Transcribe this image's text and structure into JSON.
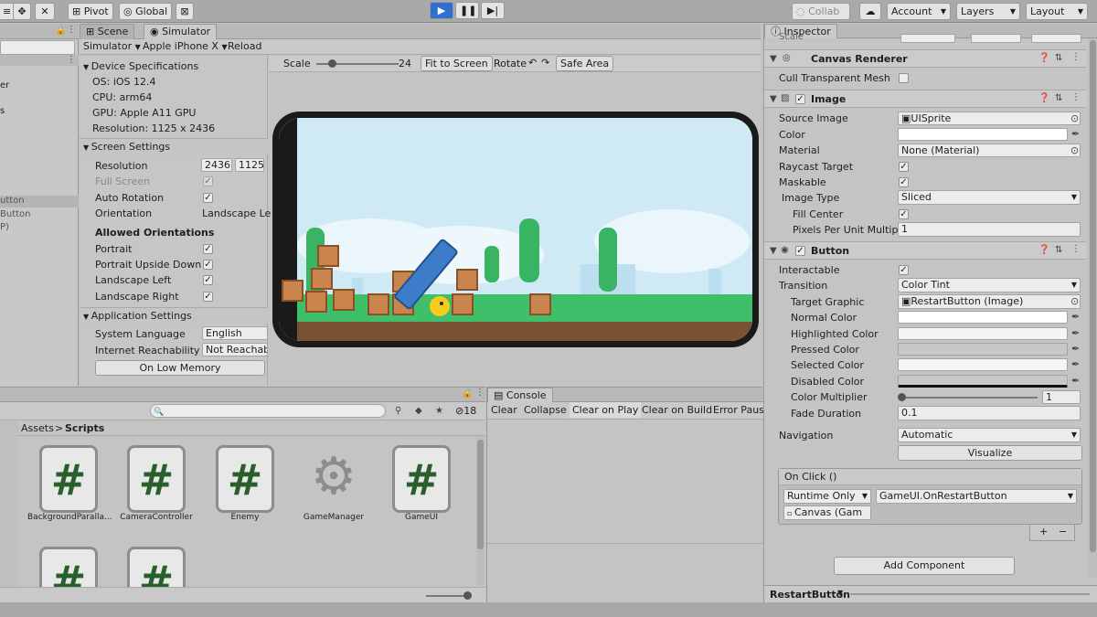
{
  "toolbar": {
    "pivot": "Pivot",
    "global": "Global",
    "collab": "Collab",
    "account": "Account",
    "layers": "Layers",
    "layout": "Layout"
  },
  "tabs": {
    "scene": "Scene",
    "simulator": "Simulator",
    "inspector": "Inspector",
    "console": "Console"
  },
  "hierarchy": {
    "items": [
      "er",
      "s",
      "",
      "",
      "utton",
      "Button",
      "P)"
    ]
  },
  "simulator": {
    "mode": "Simulator",
    "device": "Apple iPhone X",
    "reload": "Reload",
    "scale_label": "Scale",
    "scale_value": "24",
    "fit": "Fit to Screen",
    "rotate": "Rotate",
    "safe_area": "Safe Area",
    "device_spec_title": "Device Specifications",
    "os": "OS: iOS 12.4",
    "cpu": "CPU: arm64",
    "gpu": "GPU: Apple A11 GPU",
    "resolution": "Resolution: 1125 x 2436",
    "screen_settings_title": "Screen Settings",
    "res_label": "Resolution",
    "res_w": "2436",
    "res_h": "1125",
    "fullscreen": "Full Screen",
    "autorot": "Auto Rotation",
    "orientation": "Orientation",
    "orientation_val": "Landscape Le",
    "allowed_title": "Allowed Orientations",
    "portrait": "Portrait",
    "portrait_ud": "Portrait Upside Down",
    "land_left": "Landscape Left",
    "land_right": "Landscape Right",
    "app_settings_title": "Application Settings",
    "sys_lang": "System Language",
    "sys_lang_val": "English",
    "reach": "Internet Reachability",
    "reach_val": "Not Reachabl",
    "low_mem": "On Low Memory"
  },
  "project": {
    "crumb_root": "Assets",
    "crumb_sep": ">",
    "crumb_leaf": "Scripts",
    "count": "18",
    "assets": [
      "BackgroundParalla...",
      "CameraController",
      "Enemy",
      "GameManager",
      "GameUI"
    ]
  },
  "console": {
    "buttons": [
      "Clear",
      "Collapse",
      "Clear on Play",
      "Clear on Build",
      "Error Pause"
    ]
  },
  "inspector": {
    "scale_label": "Scale",
    "canvas_renderer": "Canvas Renderer",
    "cull": "Cull Transparent Mesh",
    "image_title": "Image",
    "source_image": "Source Image",
    "source_image_val": "UISprite",
    "color": "Color",
    "material": "Material",
    "material_val": "None (Material)",
    "raycast": "Raycast Target",
    "maskable": "Maskable",
    "image_type": "Image Type",
    "image_type_val": "Sliced",
    "fill_center": "Fill Center",
    "ppu": "Pixels Per Unit Multiplie",
    "ppu_val": "1",
    "button_title": "Button",
    "interactable": "Interactable",
    "transition": "Transition",
    "transition_val": "Color Tint",
    "target_graphic": "Target Graphic",
    "target_graphic_val": "RestartButton (Image)",
    "normal": "Normal Color",
    "highlighted": "Highlighted Color",
    "pressed": "Pressed Color",
    "selected": "Selected Color",
    "disabled": "Disabled Color",
    "multiplier": "Color Multiplier",
    "multiplier_val": "1",
    "fade": "Fade Duration",
    "fade_val": "0.1",
    "navigation": "Navigation",
    "navigation_val": "Automatic",
    "visualize": "Visualize",
    "onclick": "On Click ()",
    "runtime": "Runtime Only",
    "method": "GameUI.OnRestartButton",
    "canvas_obj": "Canvas (Gam",
    "plus": "+",
    "minus": "−",
    "add_component": "Add Component",
    "footer": "RestartButton"
  },
  "colors": {
    "play": "#2f6fd0",
    "sky": "#cfe9f5",
    "grass": "#3fbf6a",
    "crate": "#c9854d",
    "plank": "#3d7cc9"
  }
}
